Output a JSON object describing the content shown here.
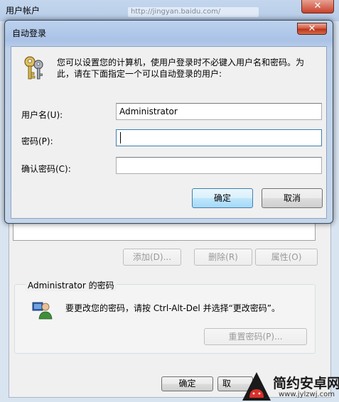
{
  "background_window": {
    "title": "用户帐户",
    "address_hint": "http://jingyan.baidu.com/",
    "close_glyph": "✕",
    "buttons": {
      "add": "添加(D)...",
      "delete": "删除(R)",
      "properties": "属性(O)"
    },
    "password_group": {
      "title": "Administrator 的密码",
      "hint": "要更改您的密码，请按 Ctrl-Alt-Del 并选择“更改密码”。",
      "reset_button": "重置密码(P)..."
    },
    "ok_button": "确定",
    "cancel_button": "取"
  },
  "dialog": {
    "title": "自动登录",
    "close_glyph": "✕",
    "description": "您可以设置您的计算机，使用户登录时不必键入用户名和密码。为此，请在下面指定一个可以自动登录的用户:",
    "fields": {
      "username_label": "用户名(U):",
      "username_value": "Administrator",
      "password_label": "密码(P):",
      "password_value": "",
      "confirm_label": "确认密码(C):",
      "confirm_value": ""
    },
    "ok_button": "确定",
    "cancel_button": "取消"
  },
  "watermark": {
    "text": "简约安卓网",
    "url": "www.jylzwj.com"
  },
  "icons": [
    "key-icon",
    "user-avatar-icon",
    "android-logo-icon"
  ],
  "colors": {
    "title_bar": "#bcd2ee",
    "close_red": "#c8412b",
    "dialog_bg": "#f0f0f0",
    "focus_blue": "#3c7fb1"
  }
}
